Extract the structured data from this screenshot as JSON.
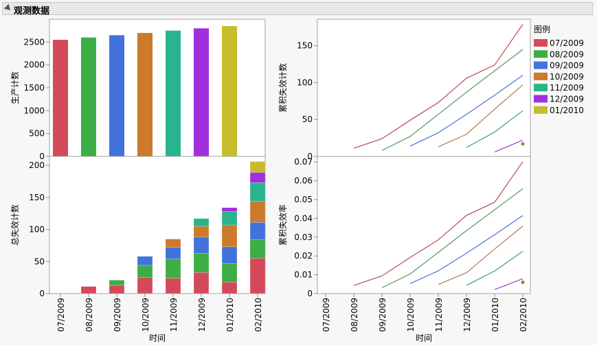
{
  "header": {
    "title": "观测数据"
  },
  "chart_data": [
    {
      "type": "bar",
      "panel": "top-left",
      "ylabel": "生产计数",
      "ylim": [
        0,
        3000
      ],
      "yticks": [
        0,
        500,
        1000,
        1500,
        2000,
        2500
      ],
      "categories": [
        "07/2009",
        "08/2009",
        "09/2009",
        "10/2009",
        "11/2009",
        "12/2009",
        "01/2010"
      ],
      "values": [
        2550,
        2600,
        2650,
        2700,
        2750,
        2800,
        2850
      ]
    },
    {
      "type": "bar",
      "stacked": true,
      "panel": "bottom-left",
      "ylabel": "总失效计数",
      "xlabel": "时间",
      "ylim": [
        0,
        214
      ],
      "yticks": [
        0,
        50,
        100,
        150,
        200
      ],
      "categories": [
        "07/2009",
        "08/2009",
        "09/2009",
        "10/2009",
        "11/2009",
        "12/2009",
        "01/2010",
        "02/2010"
      ],
      "series": [
        {
          "name": "07/2009",
          "values": [
            0,
            11,
            13,
            25,
            24,
            33,
            18,
            55
          ]
        },
        {
          "name": "08/2009",
          "values": [
            0,
            0,
            8,
            19,
            30,
            30,
            29,
            29
          ]
        },
        {
          "name": "09/2009",
          "values": [
            0,
            0,
            0,
            14,
            18,
            25,
            26,
            27
          ]
        },
        {
          "name": "10/2009",
          "values": [
            0,
            0,
            0,
            0,
            13,
            17,
            34,
            33
          ]
        },
        {
          "name": "11/2009",
          "values": [
            0,
            0,
            0,
            0,
            0,
            12,
            21,
            29
          ]
        },
        {
          "name": "12/2009",
          "values": [
            0,
            0,
            0,
            0,
            0,
            0,
            6,
            16
          ]
        },
        {
          "name": "01/2010",
          "values": [
            0,
            0,
            0,
            0,
            0,
            0,
            0,
            17
          ]
        }
      ]
    },
    {
      "type": "line",
      "panel": "top-right",
      "ylabel": "累积失效计数",
      "ylim": [
        0,
        186
      ],
      "yticks": [
        0,
        50,
        100,
        150
      ],
      "categories": [
        "07/2009",
        "08/2009",
        "09/2009",
        "10/2009",
        "11/2009",
        "12/2009",
        "01/2010",
        "02/2010"
      ],
      "series": [
        {
          "name": "07/2009",
          "values": [
            null,
            11,
            24,
            49,
            73,
            106,
            124,
            179
          ]
        },
        {
          "name": "08/2009",
          "values": [
            null,
            null,
            8,
            27,
            57,
            87,
            116,
            145
          ]
        },
        {
          "name": "09/2009",
          "values": [
            null,
            null,
            null,
            14,
            32,
            57,
            83,
            110
          ]
        },
        {
          "name": "10/2009",
          "values": [
            null,
            null,
            null,
            null,
            13,
            30,
            64,
            97
          ]
        },
        {
          "name": "11/2009",
          "values": [
            null,
            null,
            null,
            null,
            null,
            12,
            33,
            62
          ]
        },
        {
          "name": "12/2009",
          "values": [
            null,
            null,
            null,
            null,
            null,
            null,
            6,
            22
          ]
        },
        {
          "name": "01/2010",
          "values": [
            null,
            null,
            null,
            null,
            null,
            null,
            null,
            17
          ]
        }
      ]
    },
    {
      "type": "line",
      "panel": "bottom-right",
      "ylabel": "累积失效率",
      "xlabel": "时间",
      "ylim": [
        0,
        0.073
      ],
      "yticks": [
        0,
        0.01,
        0.02,
        0.03,
        0.04,
        0.05,
        0.06,
        0.07
      ],
      "categories": [
        "07/2009",
        "08/2009",
        "09/2009",
        "10/2009",
        "11/2009",
        "12/2009",
        "01/2010",
        "02/2010"
      ],
      "series": [
        {
          "name": "07/2009",
          "values": [
            null,
            0.0043,
            0.0094,
            0.0192,
            0.0286,
            0.0416,
            0.0486,
            0.0702
          ]
        },
        {
          "name": "08/2009",
          "values": [
            null,
            null,
            0.0031,
            0.0104,
            0.0219,
            0.0335,
            0.0446,
            0.0558
          ]
        },
        {
          "name": "09/2009",
          "values": [
            null,
            null,
            null,
            0.0053,
            0.0121,
            0.0215,
            0.0313,
            0.0415
          ]
        },
        {
          "name": "10/2009",
          "values": [
            null,
            null,
            null,
            null,
            0.0048,
            0.0111,
            0.0237,
            0.0359
          ]
        },
        {
          "name": "11/2009",
          "values": [
            null,
            null,
            null,
            null,
            null,
            0.0044,
            0.012,
            0.0225
          ]
        },
        {
          "name": "12/2009",
          "values": [
            null,
            null,
            null,
            null,
            null,
            null,
            0.0021,
            0.0079
          ]
        },
        {
          "name": "01/2010",
          "values": [
            null,
            null,
            null,
            null,
            null,
            null,
            null,
            0.006
          ]
        }
      ]
    }
  ],
  "legend": {
    "title": "图例",
    "placement": "right",
    "items": [
      "07/2009",
      "08/2009",
      "09/2009",
      "10/2009",
      "11/2009",
      "12/2009",
      "01/2010"
    ]
  },
  "colors": [
    "#d44a5a",
    "#3bae45",
    "#4272dc",
    "#cc7a2b",
    "#2ab48e",
    "#a12fdc",
    "#c5bd2c"
  ],
  "line_colors": [
    "#b84858",
    "#4e9a5a",
    "#4a70d8",
    "#b07a50",
    "#3a9a80",
    "#9a3ad8",
    "#8a8a2a"
  ]
}
